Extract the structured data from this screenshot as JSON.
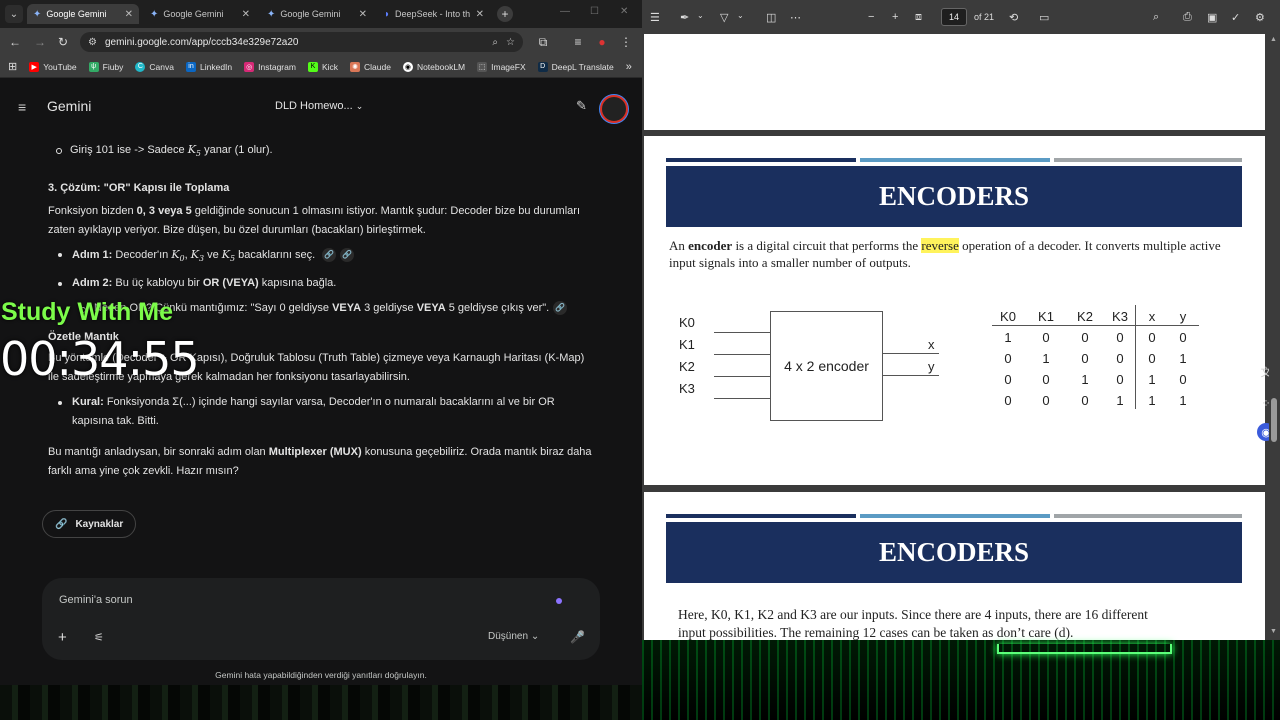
{
  "browser": {
    "tabs": [
      {
        "title": "Google Gemini",
        "active": true
      },
      {
        "title": "Google Gemini",
        "active": false
      },
      {
        "title": "Google Gemini",
        "active": false
      },
      {
        "title": "DeepSeek - Into th",
        "active": false
      }
    ],
    "url": "gemini.google.com/app/cccb34e329e72a20",
    "bookmarks": [
      "YouTube",
      "Fiuby",
      "Canva",
      "LinkedIn",
      "Instagram",
      "Kick",
      "Claude",
      "NotebookLM",
      "ImageFX",
      "DeepL Translate"
    ]
  },
  "gemini": {
    "brand": "Gemini",
    "conversation_title": "DLD Homewo...",
    "msg": {
      "line1_pre": "Giriş 101 ise -> Sadece ",
      "line1_var": "K",
      "line1_sub": "5",
      "line1_post": " yanar (1 olur).",
      "heading3": "3. Çözüm: \"OR\" Kapısı ile Toplama",
      "p1_pre": "Fonksiyon bizden ",
      "p1_bold": "0, 3 veya 5",
      "p1_post": " geldiğinde sonucun 1 olmasını istiyor. Mantık şudur: Decoder bize bu durumları zaten ayıklayıp veriyor. Bize düşen, bu özel durumları (bacakları) birleştirmek.",
      "step1_label": "Adım 1:",
      "step1_pre": " Decoder'ın ",
      "step1_k0": "K",
      "step1_k0s": "0",
      "step1_k3": "K",
      "step1_k3s": "3",
      "step1_and": " ve ",
      "step1_k5": "K",
      "step1_k5s": "5",
      "step1_post": " bacaklarını seç.",
      "step2_label": "Adım 2:",
      "step2_pre": " Bu üç kabloyu bir ",
      "step2_bold": "OR (VEYA)",
      "step2_post": " kapısına bağla.",
      "why": "Neden OR? Çünkü mantığımız: \"Sayı 0 geldiyse ",
      "why_b1": "VEYA",
      "why_m": " 3 geldiyse ",
      "why_b2": "VEYA",
      "why_end": " 5 geldiyse çıkış ver\".",
      "summary_head": "Özetle Mantık",
      "summary_p": "Bu yöntemle (Decoder + OR Kapısı), Doğruluk Tablosu (Truth Table) çizmeye veya Karnaugh Haritası (K-Map) ile sadeleştirme yapmaya gerek kalmadan her fonksiyonu tasarlayabilirsin.",
      "rule_label": "Kural:",
      "rule_text": " Fonksiyonda Σ(...) içinde hangi sayılar varsa, Decoder'ın o numaralı bacaklarını al ve bir OR kapısına tak. Bitti.",
      "closing_pre": "Bu mantığı anladıysan, bir sonraki adım olan ",
      "closing_bold": "Multiplexer (MUX)",
      "closing_post": " konusuna geçebiliriz. Orada mantık biraz daha farklı ama yine çok zevkli. Hazır mısın?"
    },
    "sources_label": "Kaynaklar",
    "input_placeholder": "Gemini'a sorun",
    "mode_label": "Düşünen",
    "disclaimer": "Gemini hata yapabildiğinden verdiği yanıtları doğrulayın."
  },
  "overlay": {
    "title": "Study With Me",
    "timer": "00:34:55"
  },
  "pdf": {
    "page_current": "14",
    "page_total": "of 21",
    "slide1": {
      "banner": "ENCODERS",
      "p_pre": "An ",
      "p_bold": "encoder",
      "p_mid": " is a digital circuit that performs the ",
      "p_hl": "reverse",
      "p_post": " operation of a decoder. It converts multiple active input signals into a smaller number of outputs.",
      "inputs": [
        "K0",
        "K1",
        "K2",
        "K3"
      ],
      "box_label": "4 x 2 encoder",
      "outputs": [
        "x",
        "y"
      ],
      "table_headers": [
        "K0",
        "K1",
        "K2",
        "K3",
        "x",
        "y"
      ],
      "table_rows": [
        [
          "1",
          "0",
          "0",
          "0",
          "0",
          "0"
        ],
        [
          "0",
          "1",
          "0",
          "0",
          "0",
          "1"
        ],
        [
          "0",
          "0",
          "1",
          "0",
          "1",
          "0"
        ],
        [
          "0",
          "0",
          "0",
          "1",
          "1",
          "1"
        ]
      ]
    },
    "slide2": {
      "banner": "ENCODERS",
      "p1": "Here, K0, K1, K2 and K3 are our inputs. Since there are 4 inputs, there are 16 different",
      "p2": "input possibilities. The remaining 12 cases can be taken as don’t care (d)."
    }
  },
  "colors": {
    "banner": "#1a2f5e",
    "highlight": "#fff35c",
    "overlay_title": "#7cfc4a"
  }
}
